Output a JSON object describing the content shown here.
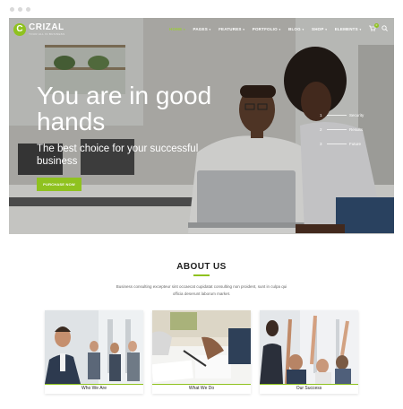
{
  "brand": {
    "name": "CRIZAL",
    "tagline": "YOUR ALL IN BUSINESS",
    "mark": "C",
    "accent": "#8fc21f"
  },
  "nav": {
    "items": [
      {
        "label": "HOME",
        "active": true
      },
      {
        "label": "PAGES",
        "active": false
      },
      {
        "label": "FEATURES",
        "active": false
      },
      {
        "label": "PORTFOLIO",
        "active": false
      },
      {
        "label": "BLOG",
        "active": false
      },
      {
        "label": "SHOP",
        "active": false
      },
      {
        "label": "ELEMENTS",
        "active": false
      }
    ],
    "cart_icon": "cart-icon",
    "cart_count": "0",
    "search_icon": "search-icon"
  },
  "hero": {
    "title": "You are in good hands",
    "subtitle": "The best choice for your successful business",
    "cta_label": "PURCHASE NOW",
    "slides": [
      {
        "number": "1",
        "label": "Security"
      },
      {
        "number": "2",
        "label": "Results"
      },
      {
        "number": "3",
        "label": "Future"
      }
    ]
  },
  "about": {
    "title": "ABOUT US",
    "text": "Business consulting excepteur sint occaecat cupidatat consulting non proident, sunt in culpa qui officia deserunt laborum market.",
    "cards": [
      {
        "label": "Who We Are"
      },
      {
        "label": "What We Do"
      },
      {
        "label": "Our Success"
      }
    ]
  }
}
